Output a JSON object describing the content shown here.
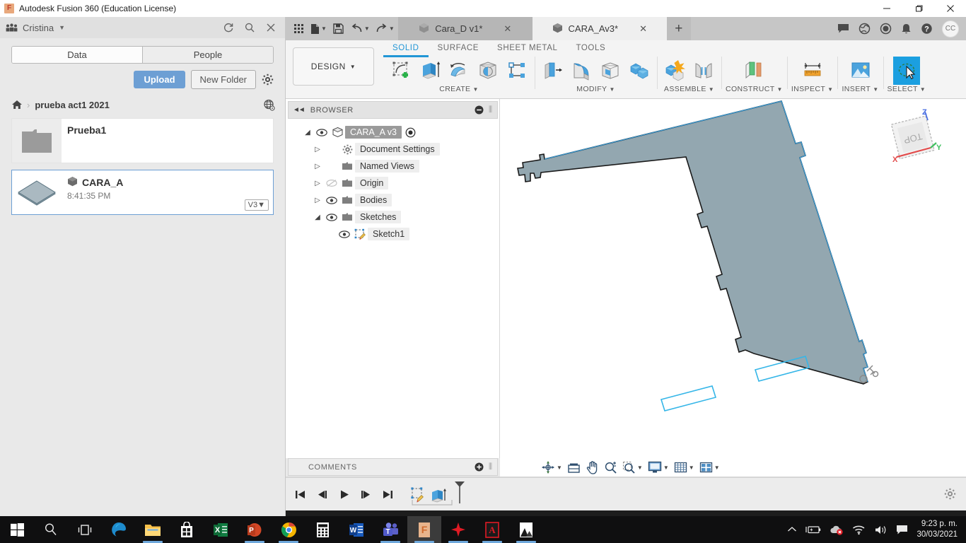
{
  "window": {
    "title": "Autodesk Fusion 360 (Education License)",
    "logo_icon": "fusion-logo-icon",
    "minimize_label": "—",
    "maximize_label": "❐",
    "close_label": "✕"
  },
  "data_panel": {
    "team_icon": "people-group-icon",
    "user": "Cristina",
    "caret": "▼",
    "refresh_icon": "refresh-icon",
    "search_icon": "search-icon",
    "close_icon": "close-icon",
    "tabs": [
      {
        "label": "Data",
        "active": true
      },
      {
        "label": "People",
        "active": false
      }
    ],
    "upload_label": "Upload",
    "new_folder_label": "New Folder",
    "settings_icon": "gear-icon",
    "breadcrumb": {
      "home_icon": "home-icon",
      "separator": "›",
      "path": "prueba act1 2021",
      "globe_icon": "globe-icon"
    },
    "items": [
      {
        "name": "Prueba1",
        "type": "folder",
        "thumb_icon": "folder-icon",
        "time": "",
        "version": "",
        "selected": false
      },
      {
        "name": "CARA_A",
        "type": "design",
        "thumb_icon": "design-thumbnail-icon",
        "name_icon": "cube-icon",
        "time": "8:41:35 PM",
        "version": "V3",
        "version_caret": "▼",
        "selected": true
      }
    ]
  },
  "tabstrip": {
    "quick_access": [
      {
        "name": "show-data-panel-button",
        "icon": "grid-icon",
        "caret": false
      },
      {
        "name": "file-button",
        "icon": "file-icon",
        "caret": true
      },
      {
        "name": "save-button",
        "icon": "save-icon",
        "caret": false
      },
      {
        "name": "undo-button",
        "icon": "undo-icon",
        "caret": true
      },
      {
        "name": "redo-button",
        "icon": "redo-icon",
        "caret": true
      }
    ],
    "doc_tabs": [
      {
        "label": "Cara_D v1*",
        "icon": "cube-icon",
        "active": false,
        "close": "✕"
      },
      {
        "label": "CARA_Av3*",
        "icon": "cube-icon",
        "active": true,
        "close": "✕"
      }
    ],
    "new_tab_label": "+",
    "right_icons": [
      {
        "name": "comments-icon",
        "glyph": "chat-icon"
      },
      {
        "name": "help-globe-icon",
        "glyph": "globe-icon"
      },
      {
        "name": "job-status-icon",
        "glyph": "clock-icon"
      },
      {
        "name": "notifications-icon",
        "glyph": "bell-icon"
      },
      {
        "name": "help-icon",
        "glyph": "question-icon"
      }
    ],
    "avatar_initials": "CC"
  },
  "ribbon": {
    "workspace_label": "DESIGN",
    "workspace_caret": "▼",
    "tabs": [
      {
        "label": "SOLID",
        "active": true
      },
      {
        "label": "SURFACE",
        "active": false
      },
      {
        "label": "SHEET METAL",
        "active": false
      },
      {
        "label": "TOOLS",
        "active": false
      }
    ],
    "groups": [
      {
        "label": "CREATE",
        "caret": "▼",
        "tools": [
          {
            "name": "create-sketch-button",
            "icon": "new-sketch-icon"
          },
          {
            "name": "extrude-button",
            "icon": "extrude-icon"
          },
          {
            "name": "revolve-button",
            "icon": "revolve-icon"
          },
          {
            "name": "sphere-button",
            "icon": "sphere-icon"
          },
          {
            "name": "pattern-button",
            "icon": "pattern-icon"
          }
        ]
      },
      {
        "label": "MODIFY",
        "caret": "▼",
        "tools": [
          {
            "name": "press-pull-button",
            "icon": "press-pull-icon"
          },
          {
            "name": "fillet-button",
            "icon": "fillet-icon"
          },
          {
            "name": "shell-button",
            "icon": "shell-icon"
          },
          {
            "name": "combine-button",
            "icon": "combine-icon"
          }
        ]
      },
      {
        "label": "ASSEMBLE",
        "caret": "▼",
        "tools": [
          {
            "name": "new-component-button",
            "icon": "new-component-icon"
          },
          {
            "name": "joint-button",
            "icon": "joint-icon"
          }
        ]
      },
      {
        "label": "CONSTRUCT",
        "caret": "▼",
        "tools": [
          {
            "name": "offset-plane-button",
            "icon": "offset-plane-icon"
          }
        ]
      },
      {
        "label": "INSPECT",
        "caret": "▼",
        "tools": [
          {
            "name": "measure-button",
            "icon": "measure-ruler-icon"
          }
        ]
      },
      {
        "label": "INSERT",
        "caret": "▼",
        "tools": [
          {
            "name": "insert-image-button",
            "icon": "image-icon"
          }
        ]
      },
      {
        "label": "SELECT",
        "caret": "▼",
        "selected": true,
        "tools": [
          {
            "name": "select-tool-button",
            "icon": "select-lasso-cursor-icon"
          }
        ]
      }
    ]
  },
  "browser": {
    "collapse_icon": "collapse-left-icon",
    "title": "BROWSER",
    "minus_icon": "minus-circle-icon",
    "grip_icon": "grip-icon",
    "tree": [
      {
        "label": "CARA_A v3",
        "depth": 0,
        "arrow": "◢",
        "eye": "eye-visible-icon",
        "icon": "component-cube-icon",
        "root": true,
        "dot": "radio-dot-icon"
      },
      {
        "label": "Document Settings",
        "depth": 1,
        "arrow": "▷",
        "eye": "",
        "icon": "gear-icon"
      },
      {
        "label": "Named Views",
        "depth": 1,
        "arrow": "▷",
        "eye": "",
        "icon": "folder-icon"
      },
      {
        "label": "Origin",
        "depth": 1,
        "arrow": "▷",
        "eye": "eye-hidden-icon",
        "icon": "folder-icon"
      },
      {
        "label": "Bodies",
        "depth": 1,
        "arrow": "▷",
        "eye": "eye-visible-icon",
        "icon": "folder-icon"
      },
      {
        "label": "Sketches",
        "depth": 1,
        "arrow": "◢",
        "eye": "eye-visible-icon",
        "icon": "folder-icon"
      },
      {
        "label": "Sketch1",
        "depth": 2,
        "arrow": "",
        "eye": "eye-visible-icon",
        "icon": "sketch-icon"
      }
    ]
  },
  "comments": {
    "title": "COMMENTS",
    "add_icon": "plus-circle-icon",
    "grip_icon": "grip-icon"
  },
  "viewport": {
    "model_name": "CARA_A",
    "body_fill": "#93a7b0",
    "edge_color": "#1a1a1a",
    "sketch_color": "#35b6e8",
    "joint_marker_icon": "joint-origin-icon",
    "viewcube": {
      "face_label": "TOP",
      "axis_x": "X",
      "axis_y": "Y",
      "axis_z": "Z",
      "color_x": "#e24a4a",
      "color_y": "#3fbf5f",
      "color_z": "#4a6fe2"
    }
  },
  "navbar": {
    "tools": [
      {
        "name": "orbit-button",
        "icon": "orbit-icon",
        "caret": true
      },
      {
        "name": "look-at-button",
        "icon": "look-at-icon",
        "caret": false
      },
      {
        "name": "pan-button",
        "icon": "pan-hand-icon",
        "caret": false
      },
      {
        "name": "zoom-button",
        "icon": "zoom-magnifier-icon",
        "caret": false
      },
      {
        "name": "fit-button",
        "icon": "fit-window-icon",
        "caret": true
      },
      {
        "name": "display-settings-button",
        "icon": "monitor-icon",
        "caret": true
      },
      {
        "name": "grid-snaps-button",
        "icon": "grid-icon",
        "caret": true
      },
      {
        "name": "viewports-button",
        "icon": "viewports-icon",
        "caret": true
      }
    ]
  },
  "timeline": {
    "controls": [
      {
        "name": "jump-to-beginning-button",
        "icon": "skip-back-icon"
      },
      {
        "name": "step-back-button",
        "icon": "step-back-icon"
      },
      {
        "name": "play-button",
        "icon": "play-icon"
      },
      {
        "name": "step-forward-button",
        "icon": "step-forward-icon"
      },
      {
        "name": "jump-to-end-button",
        "icon": "skip-forward-icon"
      }
    ],
    "features": [
      {
        "name": "timeline-feature-sketch",
        "icon": "sketch-feature-icon"
      },
      {
        "name": "timeline-feature-extrude",
        "icon": "extrude-feature-icon"
      }
    ],
    "settings_icon": "gear-icon"
  },
  "taskbar": {
    "items": [
      {
        "name": "start-button",
        "icon": "windows-logo-icon",
        "active": false,
        "running": false
      },
      {
        "name": "search-button",
        "icon": "search-icon",
        "active": false,
        "running": false
      },
      {
        "name": "task-view-button",
        "icon": "task-view-icon",
        "active": false,
        "running": false
      },
      {
        "name": "edge-button",
        "icon": "edge-icon",
        "active": false,
        "running": false
      },
      {
        "name": "file-explorer-button",
        "icon": "folder-icon",
        "active": false,
        "running": true
      },
      {
        "name": "microsoft-store-button",
        "icon": "store-bag-icon",
        "active": false,
        "running": false
      },
      {
        "name": "excel-button",
        "icon": "excel-icon",
        "active": false,
        "running": false
      },
      {
        "name": "powerpoint-button",
        "icon": "powerpoint-icon",
        "active": false,
        "running": true
      },
      {
        "name": "chrome-button",
        "icon": "chrome-icon",
        "active": false,
        "running": true
      },
      {
        "name": "calculator-button",
        "icon": "calculator-icon",
        "active": false,
        "running": false
      },
      {
        "name": "word-button",
        "icon": "word-icon",
        "active": false,
        "running": false
      },
      {
        "name": "teams-button",
        "icon": "teams-icon",
        "active": false,
        "running": true
      },
      {
        "name": "fusion360-button",
        "icon": "fusion-logo-icon",
        "active": true,
        "running": true
      },
      {
        "name": "autodesk-app-button",
        "icon": "autodesk-star-icon",
        "active": false,
        "running": true
      },
      {
        "name": "acrobat-button",
        "icon": "acrobat-icon",
        "active": false,
        "running": true
      },
      {
        "name": "photos-button",
        "icon": "photos-icon",
        "active": false,
        "running": true
      }
    ],
    "tray": [
      {
        "name": "show-hidden-icons-button",
        "icon": "chevron-up-icon"
      },
      {
        "name": "battery-icon",
        "icon": "battery-charging-icon"
      },
      {
        "name": "onedrive-icon",
        "icon": "cloud-error-icon"
      },
      {
        "name": "network-icon",
        "icon": "wifi-icon"
      },
      {
        "name": "volume-icon",
        "icon": "speaker-icon"
      },
      {
        "name": "action-center-button",
        "icon": "notification-icon"
      }
    ],
    "clock_time": "9:23 p. m.",
    "clock_date": "30/03/2021"
  }
}
